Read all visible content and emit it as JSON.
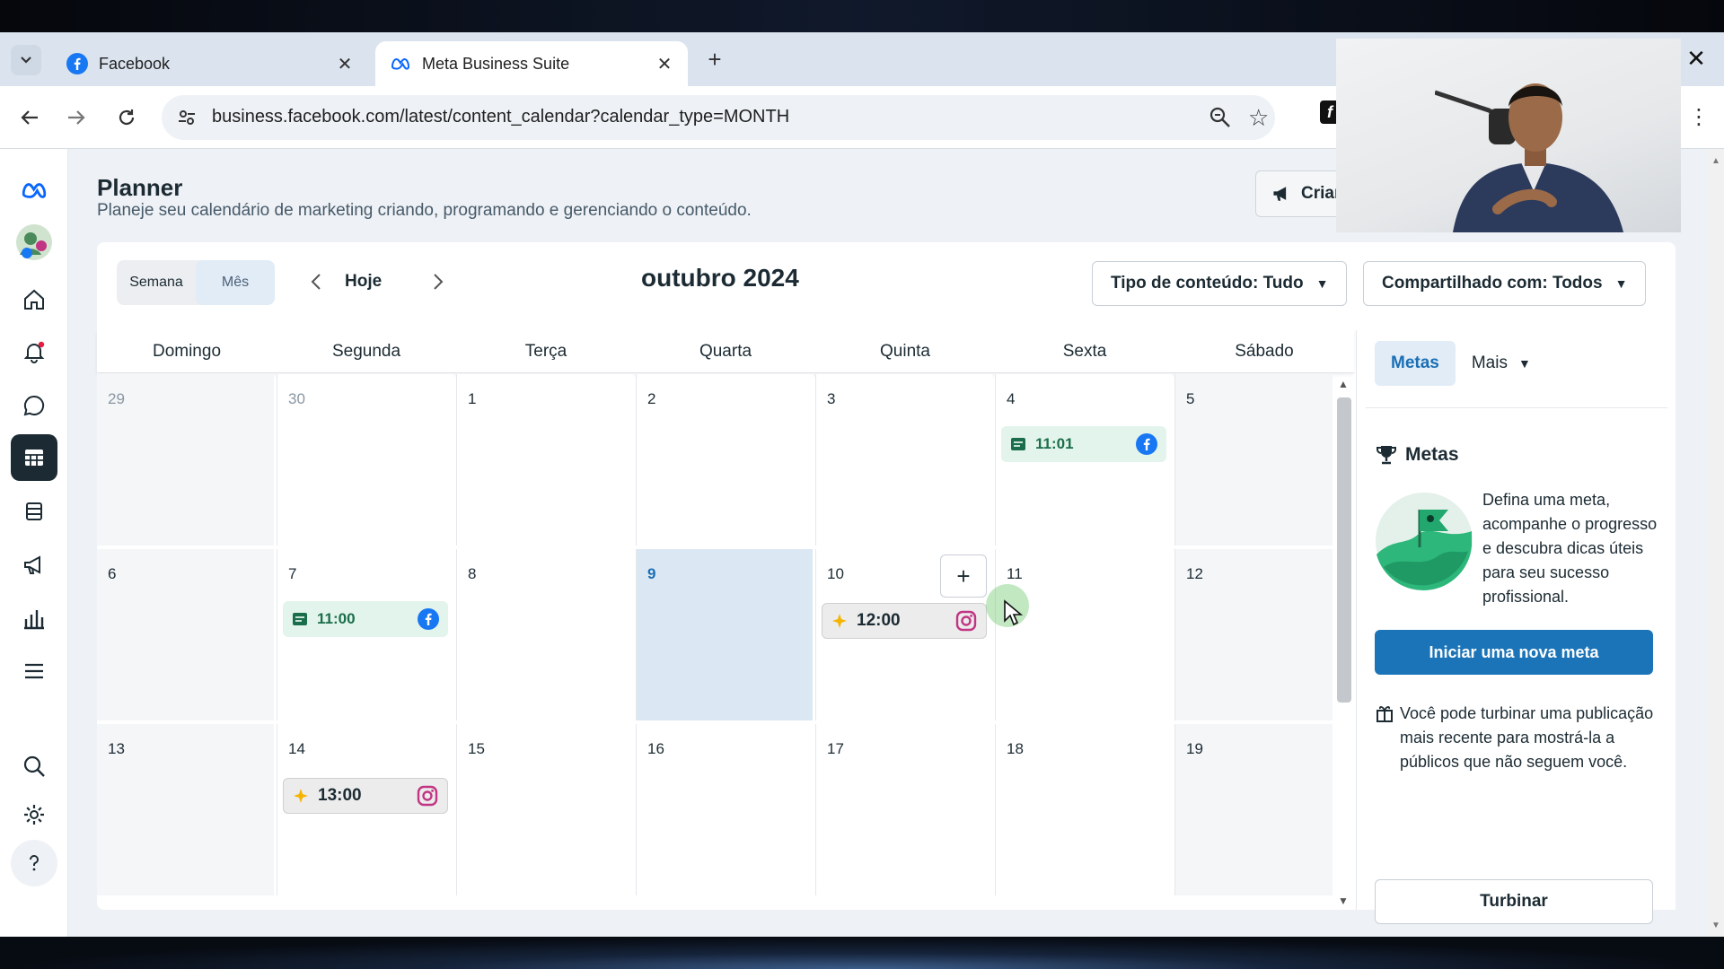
{
  "browser": {
    "tabs": [
      {
        "title": "Facebook",
        "active": false,
        "icon": "facebook-icon"
      },
      {
        "title": "Meta Business Suite",
        "active": true,
        "icon": "meta-icon"
      }
    ],
    "url": "business.facebook.com/latest/content_calendar?calendar_type=MONTH"
  },
  "page": {
    "title": "Planner",
    "subtitle": "Planeje seu calendário de marketing criando, programando e gerenciando o conteúdo.",
    "create_label": "Criar"
  },
  "calendar": {
    "view_week": "Semana",
    "view_month": "Mês",
    "selected_view": "Mês",
    "today_label": "Hoje",
    "month_title": "outubro 2024",
    "filter_content": "Tipo de conteúdo: Tudo",
    "filter_shared": "Compartilhado com: Todos",
    "weekdays": [
      "Domingo",
      "Segunda",
      "Terça",
      "Quarta",
      "Quinta",
      "Sexta",
      "Sábado"
    ],
    "weeks": [
      [
        "29",
        "30",
        "1",
        "2",
        "3",
        "4",
        "5"
      ],
      [
        "6",
        "7",
        "8",
        "9",
        "10",
        "11",
        "12"
      ],
      [
        "13",
        "14",
        "15",
        "16",
        "17",
        "18",
        "19"
      ]
    ],
    "today": "9",
    "events": [
      {
        "day": "4",
        "time": "11:01",
        "kind": "post",
        "network": "facebook"
      },
      {
        "day": "7",
        "time": "11:00",
        "kind": "post",
        "network": "facebook"
      },
      {
        "day": "10",
        "time": "12:00",
        "kind": "story",
        "network": "instagram"
      },
      {
        "day": "14",
        "time": "13:00",
        "kind": "story",
        "network": "instagram"
      }
    ]
  },
  "side_panel": {
    "tab_goals": "Metas",
    "tab_more": "Mais",
    "goals_title": "Metas",
    "goals_text": "Defina uma meta, acompanhe o progresso e descubra dicas úteis para seu sucesso profissional.",
    "goals_button": "Iniciar uma nova meta",
    "boost_text": "Você pode turbinar uma publicação mais recente para mostrá-la a públicos que não seguem você.",
    "boost_button": "Turbinar"
  },
  "colors": {
    "primary": "#1b74b7",
    "today_cell": "#dbe8f4",
    "post_event": "#e3f4ec",
    "facebook": "#1877f2",
    "instagram": "#c13584"
  }
}
